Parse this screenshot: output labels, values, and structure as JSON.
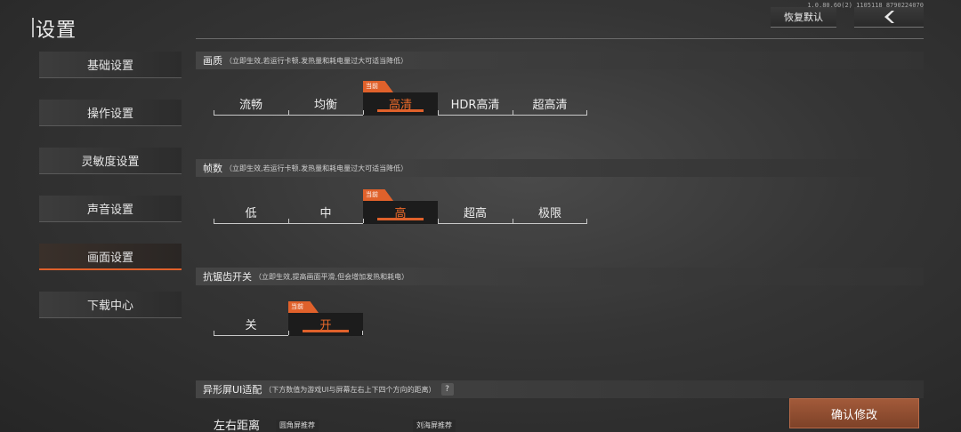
{
  "header": {
    "title": "设置",
    "version": "1.0.80.60(2) 1105118 8790224070",
    "reset_label": "恢复默认",
    "back_icon": "chevron-left-icon"
  },
  "sidebar": {
    "items": [
      {
        "label": "基础设置",
        "active": false
      },
      {
        "label": "操作设置",
        "active": false
      },
      {
        "label": "灵敏度设置",
        "active": false
      },
      {
        "label": "声音设置",
        "active": false
      },
      {
        "label": "画面设置",
        "active": true
      },
      {
        "label": "下载中心",
        "active": false
      }
    ]
  },
  "current_tag": "当前",
  "sections": {
    "quality": {
      "title": "画质",
      "hint": "（立即生效,若运行卡顿.发热量和耗电量过大可适当降低）",
      "options": [
        "流畅",
        "均衡",
        "高清",
        "HDR高清",
        "超高清"
      ],
      "selected": "高清"
    },
    "framerate": {
      "title": "帧数",
      "hint": "（立即生效,若运行卡顿.发热量和耗电量过大可适当降低）",
      "options": [
        "低",
        "中",
        "高",
        "超高",
        "极限"
      ],
      "selected": "高"
    },
    "antialias": {
      "title": "抗锯齿开关",
      "hint": "（立即生效,提高画面平滑,但会增加发热和耗电）",
      "options": [
        "关",
        "开"
      ],
      "selected": "开"
    },
    "notch": {
      "title": "异形屏UI适配",
      "hint": "（下方数值为游戏UI与屏幕左右上下四个方向的距离）",
      "help": "?",
      "lr_label": "左右距离",
      "rec_round": "圆角屏推荐",
      "rec_notch": "刘海屏推荐"
    }
  },
  "confirm_label": "确认修改",
  "colors": {
    "accent": "#e0612b",
    "confirm": "#8e4c30"
  }
}
